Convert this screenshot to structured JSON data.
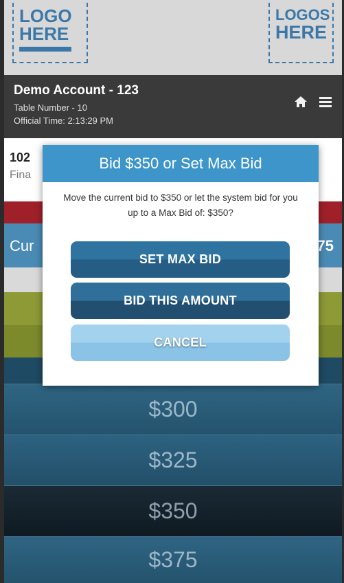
{
  "logos": {
    "left_line1": "LOGO",
    "left_line2": "HERE",
    "right_line1": "LOGOS",
    "right_line2": "HERE"
  },
  "account": {
    "title": "Demo Account - 123",
    "table_number": "Table Number - 10",
    "official_time": "Official Time: 2:13:29 PM",
    "home_icon": "home-icon",
    "menu_icon": "hamburger-menu-icon"
  },
  "item": {
    "number_partial": "102",
    "subtitle_partial": "Fina"
  },
  "current_bid": {
    "label_partial": "Cur",
    "value_partial": "75"
  },
  "modal": {
    "title": "Bid $350 or Set Max Bid",
    "message": "Move the current bid to $350 or let the system bid for you up to a Max Bid of: $350?",
    "set_max_bid_label": "SET MAX BID",
    "bid_this_amount_label": "BID THIS AMOUNT",
    "cancel_label": "CANCEL"
  },
  "amounts": [
    "$300",
    "$325",
    "$350",
    "$375"
  ]
}
